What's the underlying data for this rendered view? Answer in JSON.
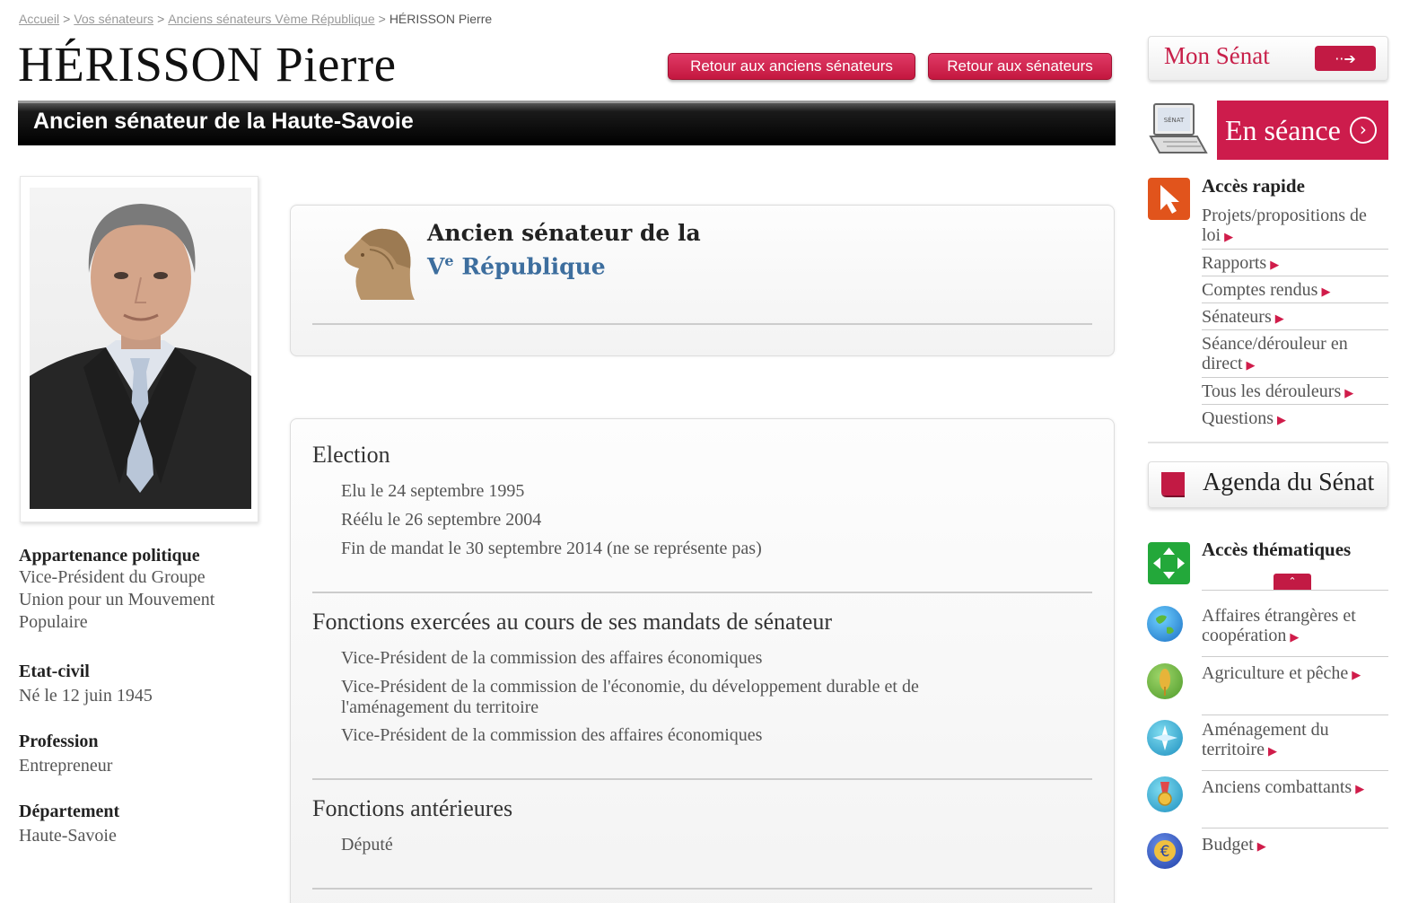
{
  "breadcrumb": {
    "home": "Accueil",
    "senators": "Vos sénateurs",
    "former": "Anciens sénateurs Vème République",
    "current": "HÉRISSON Pierre",
    "separator": ">"
  },
  "header": {
    "title": "HÉRISSON Pierre",
    "subtitle": "Ancien sénateur de la Haute-Savoie",
    "btn_former_senators": "Retour aux anciens sénateurs",
    "btn_senators": "Retour aux sénateurs"
  },
  "profile": {
    "political_label": "Appartenance politique",
    "political_value": "Vice-Président du Groupe Union pour un Mouvement Populaire",
    "civil_label": "Etat-civil",
    "civil_value": "Né le 12 juin 1945",
    "profession_label": "Profession",
    "profession_value": "Entrepreneur",
    "department_label": "Département",
    "department_value": "Haute-Savoie"
  },
  "republic_card": {
    "line1": "Ancien sénateur de la",
    "roman": "V",
    "sup": "e",
    "word": "République"
  },
  "election": {
    "title": "Election",
    "items": [
      "Elu le 24 septembre 1995",
      "Réélu le 26 septembre 2004",
      "Fin de mandat le 30 septembre 2014 (ne se représente pas)"
    ]
  },
  "functions": {
    "title": "Fonctions exercées au cours de ses mandats de sénateur",
    "items": [
      "Vice-Président de la commission des affaires économiques",
      "Vice-Président de la commission de l'économie, du développement durable et de l'aménagement du territoire",
      "Vice-Président de la commission des affaires économiques"
    ]
  },
  "previous": {
    "title": "Fonctions antérieures",
    "items": [
      "Député"
    ]
  },
  "sidebar": {
    "mon_senat": "Mon Sénat",
    "mon_senat_btn": "··➔",
    "en_seance": "En séance",
    "en_seance_arrow": "›",
    "acces_rapide": "Accès rapide",
    "quick_links": [
      "Projets/propositions de loi",
      "Rapports",
      "Comptes rendus",
      "Sénateurs",
      "Séance/dérouleur en direct",
      "Tous les dérouleurs",
      "Questions"
    ],
    "agenda": "Agenda du Sénat",
    "acces_thematiques": "Accès thématiques",
    "collapse": "⌃",
    "themes": [
      "Affaires étrangères et coopération",
      "Agriculture et pêche",
      "Aménagement du territoire",
      "Anciens combattants",
      "Budget"
    ],
    "arrow_glyph": "▶",
    "laptop_screen_text": "SÉNAT"
  },
  "colors": {
    "accent": "#cd1c4c",
    "link_blue": "#3d6e9e",
    "title_bar": "#000000"
  }
}
